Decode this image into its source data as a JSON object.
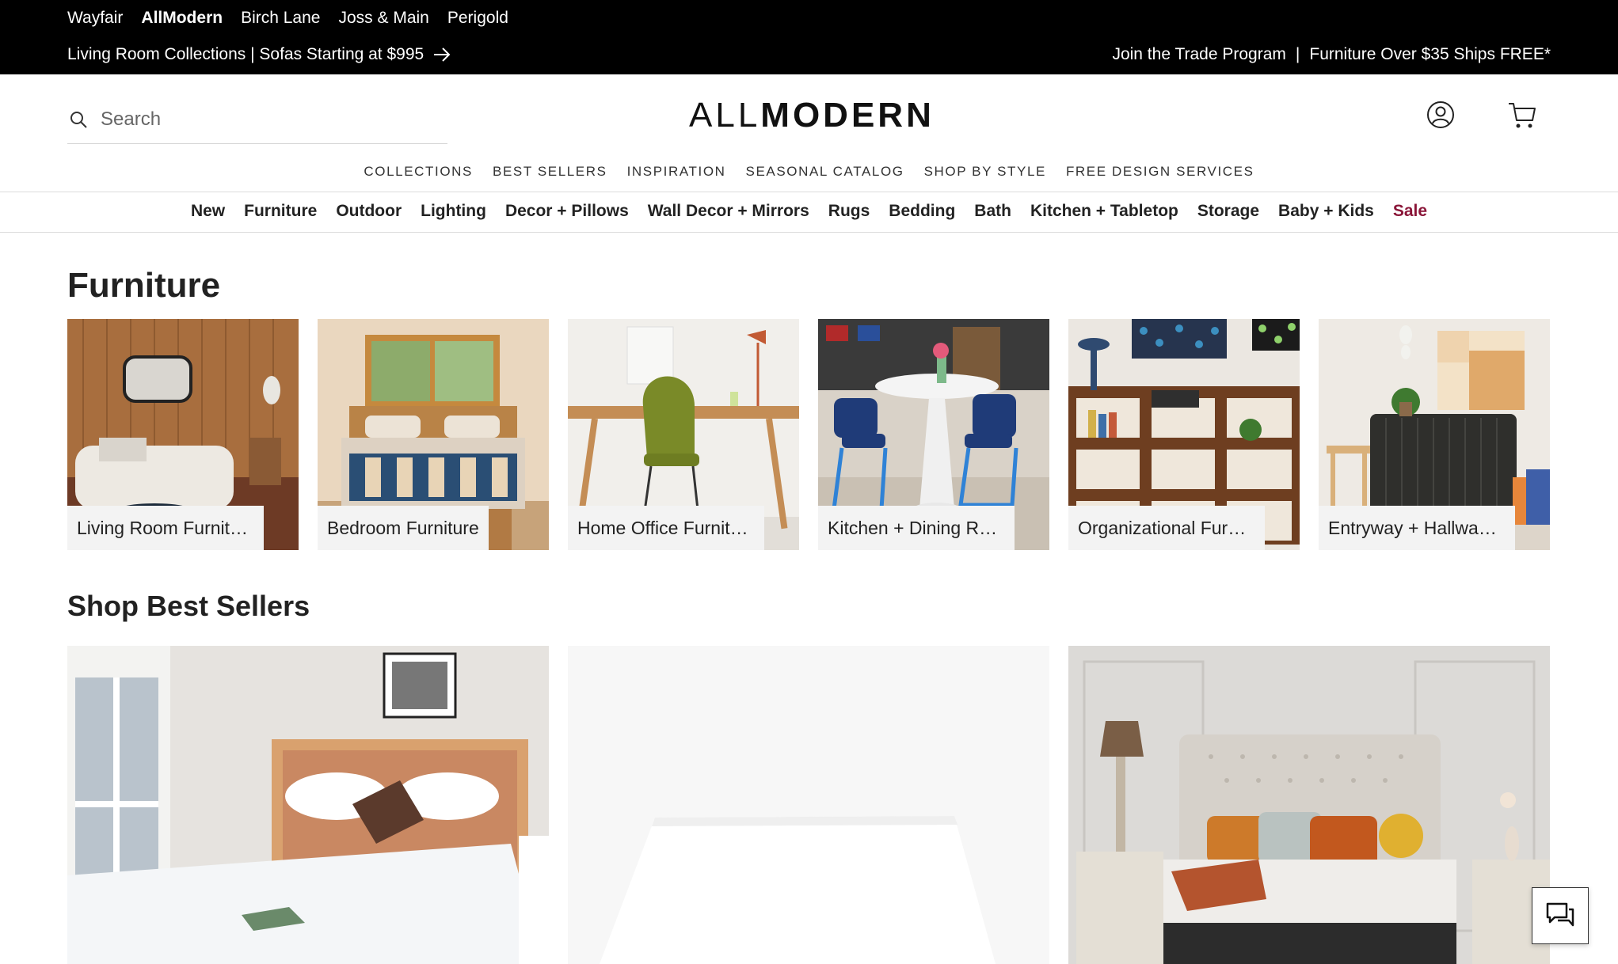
{
  "brands": [
    {
      "label": "Wayfair",
      "active": false
    },
    {
      "label": "AllModern",
      "active": true
    },
    {
      "label": "Birch Lane",
      "active": false
    },
    {
      "label": "Joss & Main",
      "active": false
    },
    {
      "label": "Perigold",
      "active": false
    }
  ],
  "promo": {
    "left": "Living Room Collections | Sofas Starting at $995",
    "right_1": "Join the Trade Program",
    "right_sep": "|",
    "right_2": "Furniture Over $35 Ships FREE*"
  },
  "search": {
    "placeholder": "Search"
  },
  "logo": {
    "part1": "ALL",
    "part2": "MODERN"
  },
  "utility_nav": [
    "COLLECTIONS",
    "BEST SELLERS",
    "INSPIRATION",
    "SEASONAL CATALOG",
    "SHOP BY STYLE",
    "FREE DESIGN SERVICES"
  ],
  "category_nav": [
    "New",
    "Furniture",
    "Outdoor",
    "Lighting",
    "Decor + Pillows",
    "Wall Decor + Mirrors",
    "Rugs",
    "Bedding",
    "Bath",
    "Kitchen + Tabletop",
    "Storage",
    "Baby + Kids",
    "Sale"
  ],
  "furniture": {
    "title": "Furniture",
    "tiles": [
      {
        "label": "Living Room Furniture"
      },
      {
        "label": "Bedroom Furniture"
      },
      {
        "label": "Home Office Furniture"
      },
      {
        "label": "Kitchen + Dining Room Furniture"
      },
      {
        "label": "Organizational Furniture"
      },
      {
        "label": "Entryway + Hallway Furniture"
      }
    ]
  },
  "best_sellers": {
    "title": "Shop Best Sellers"
  },
  "colors": {
    "sale": "#8a1538",
    "topbar": "#000000"
  },
  "icons": {
    "search": "search-icon",
    "account": "account-icon",
    "cart": "cart-icon",
    "arrow": "arrow-right-icon",
    "chat": "chat-icon"
  }
}
